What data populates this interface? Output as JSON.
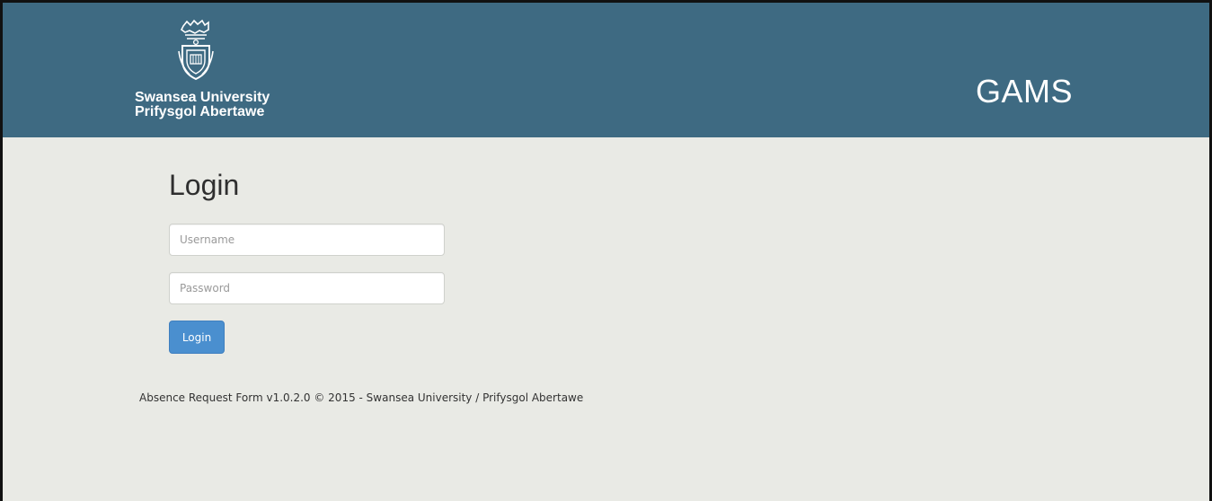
{
  "header": {
    "logo": {
      "line1": "Swansea University",
      "line2": "Prifysgol Abertawe",
      "icon": "university-crest-icon"
    },
    "app_name": "GAMS"
  },
  "login": {
    "title": "Login",
    "username_placeholder": "Username",
    "username_value": "",
    "password_placeholder": "Password",
    "password_value": "",
    "button_label": "Login"
  },
  "footer": {
    "text": "Absence Request Form v1.0.2.0 © 2015 - Swansea University / Prifysgol Abertawe"
  },
  "colors": {
    "header_bg": "#3e6a82",
    "page_bg": "#e9eae5",
    "button_bg": "#4a8fcf"
  }
}
